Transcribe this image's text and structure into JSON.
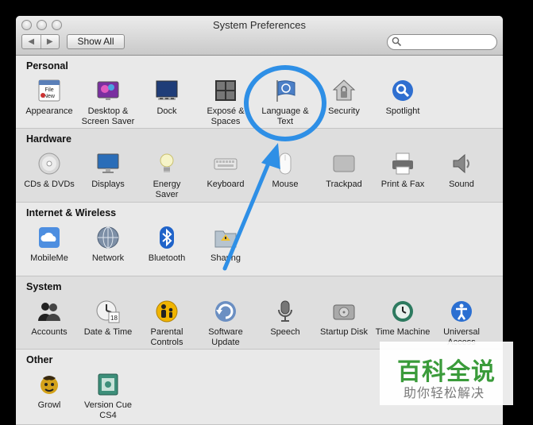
{
  "window": {
    "title": "System Preferences"
  },
  "toolbar": {
    "back_glyph": "◀",
    "forward_glyph": "▶",
    "show_all_label": "Show All",
    "search_placeholder": ""
  },
  "sections": [
    {
      "title": "Personal",
      "panes": [
        {
          "label": "Appearance",
          "icon": "appearance-icon"
        },
        {
          "label": "Desktop &\nScreen Saver",
          "icon": "desktop-screensaver-icon"
        },
        {
          "label": "Dock",
          "icon": "dock-icon"
        },
        {
          "label": "Exposé &\nSpaces",
          "icon": "expose-spaces-icon"
        },
        {
          "label": "Language &\nText",
          "icon": "language-text-icon"
        },
        {
          "label": "Security",
          "icon": "security-house-icon"
        },
        {
          "label": "Spotlight",
          "icon": "spotlight-icon"
        }
      ]
    },
    {
      "title": "Hardware",
      "panes": [
        {
          "label": "CDs & DVDs",
          "icon": "cd-icon"
        },
        {
          "label": "Displays",
          "icon": "display-icon"
        },
        {
          "label": "Energy\nSaver",
          "icon": "lightbulb-icon"
        },
        {
          "label": "Keyboard",
          "icon": "keyboard-icon"
        },
        {
          "label": "Mouse",
          "icon": "mouse-icon"
        },
        {
          "label": "Trackpad",
          "icon": "trackpad-icon"
        },
        {
          "label": "Print & Fax",
          "icon": "printer-icon"
        },
        {
          "label": "Sound",
          "icon": "speaker-icon"
        }
      ]
    },
    {
      "title": "Internet & Wireless",
      "panes": [
        {
          "label": "MobileMe",
          "icon": "mobileme-cloud-icon"
        },
        {
          "label": "Network",
          "icon": "network-globe-icon"
        },
        {
          "label": "Bluetooth",
          "icon": "bluetooth-icon"
        },
        {
          "label": "Sharing",
          "icon": "sharing-folder-icon"
        }
      ]
    },
    {
      "title": "System",
      "panes": [
        {
          "label": "Accounts",
          "icon": "accounts-icon"
        },
        {
          "label": "Date & Time",
          "icon": "date-time-icon",
          "calendar_day": "18"
        },
        {
          "label": "Parental\nControls",
          "icon": "parental-controls-icon"
        },
        {
          "label": "Software\nUpdate",
          "icon": "software-update-icon"
        },
        {
          "label": "Speech",
          "icon": "microphone-icon"
        },
        {
          "label": "Startup Disk",
          "icon": "startup-disk-icon"
        },
        {
          "label": "Time Machine",
          "icon": "time-machine-icon"
        },
        {
          "label": "Universal\nAccess",
          "icon": "universal-access-icon"
        }
      ]
    },
    {
      "title": "Other",
      "panes": [
        {
          "label": "Growl",
          "icon": "growl-icon"
        },
        {
          "label": "Version Cue\nCS4",
          "icon": "version-cue-icon"
        }
      ]
    }
  ],
  "annotation": {
    "highlight_color": "#2e8fe6",
    "highlighted_pane": "Language & Text"
  },
  "watermark": {
    "main_text": "百科全说",
    "sub_text": "助你轻松解决",
    "color": "#3a9b3a"
  }
}
